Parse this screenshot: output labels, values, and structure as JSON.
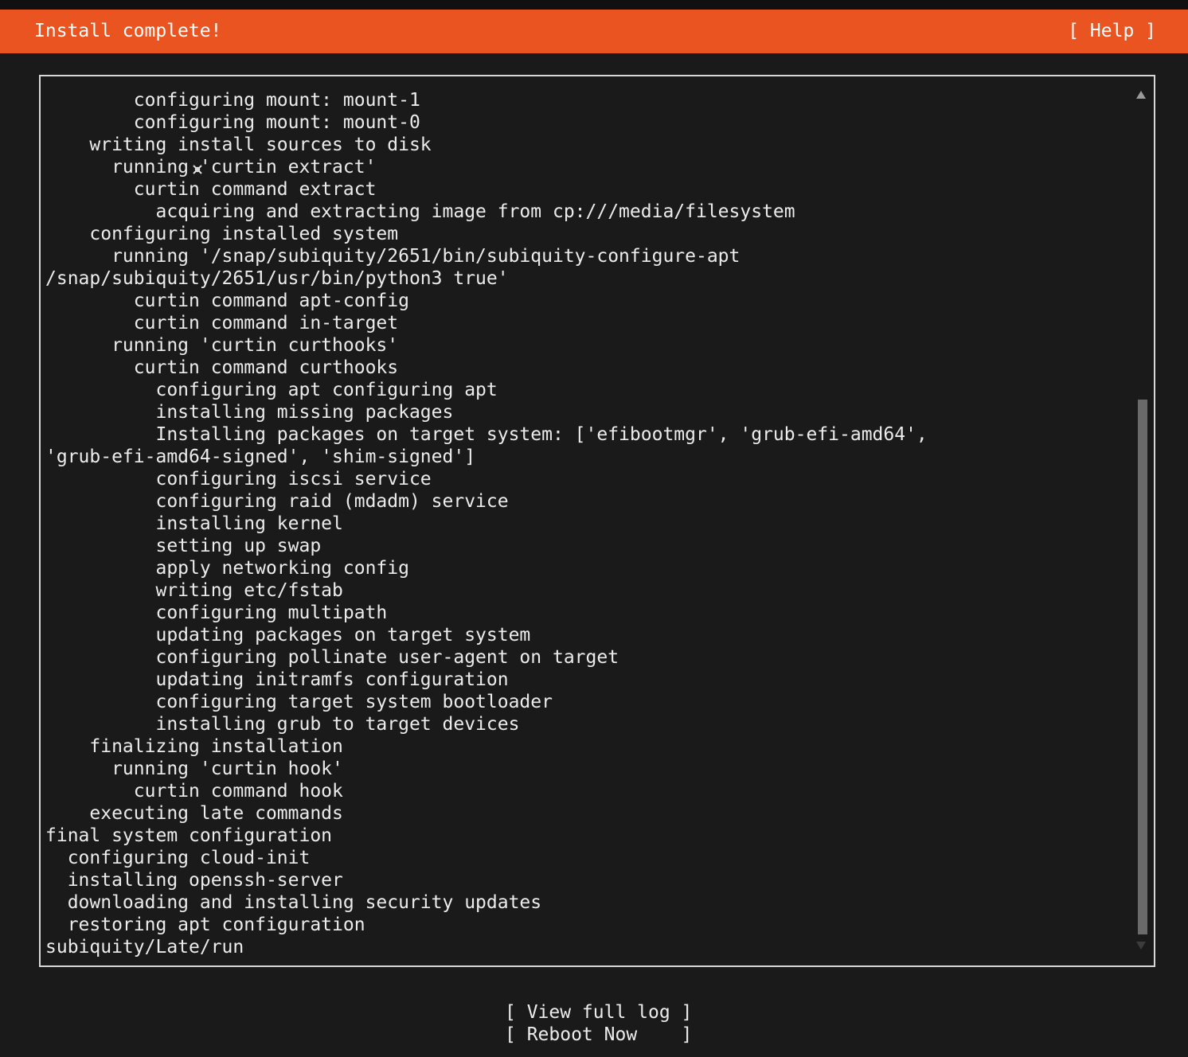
{
  "header": {
    "title": "Install complete!",
    "help": "[ Help ]"
  },
  "log": {
    "lines": [
      "        configuring mount: mount-1",
      "        configuring mount: mount-0",
      "    writing install sources to disk",
      "      running 'curtin extract'",
      "        curtin command extract",
      "          acquiring and extracting image from cp:///media/filesystem",
      "    configuring installed system",
      "      running '/snap/subiquity/2651/bin/subiquity-configure-apt",
      "/snap/subiquity/2651/usr/bin/python3 true'",
      "        curtin command apt-config",
      "        curtin command in-target",
      "      running 'curtin curthooks'",
      "        curtin command curthooks",
      "          configuring apt configuring apt",
      "          installing missing packages",
      "          Installing packages on target system: ['efibootmgr', 'grub-efi-amd64',",
      "'grub-efi-amd64-signed', 'shim-signed']",
      "          configuring iscsi service",
      "          configuring raid (mdadm) service",
      "          installing kernel",
      "          setting up swap",
      "          apply networking config",
      "          writing etc/fstab",
      "          configuring multipath",
      "          updating packages on target system",
      "          configuring pollinate user-agent on target",
      "          updating initramfs configuration",
      "          configuring target system bootloader",
      "          installing grub to target devices",
      "    finalizing installation",
      "      running 'curtin hook'",
      "        curtin command hook",
      "    executing late commands",
      "final system configuration",
      "  configuring cloud-init",
      "  installing openssh-server",
      "  downloading and installing security updates",
      "  restoring apt configuration",
      "subiquity/Late/run"
    ]
  },
  "actions": {
    "view_log": "[ View full log ]",
    "reboot": "[ Reboot Now    ]"
  },
  "colors": {
    "accent": "#e95420",
    "background": "#1a1a1a",
    "text": "#ececec"
  }
}
